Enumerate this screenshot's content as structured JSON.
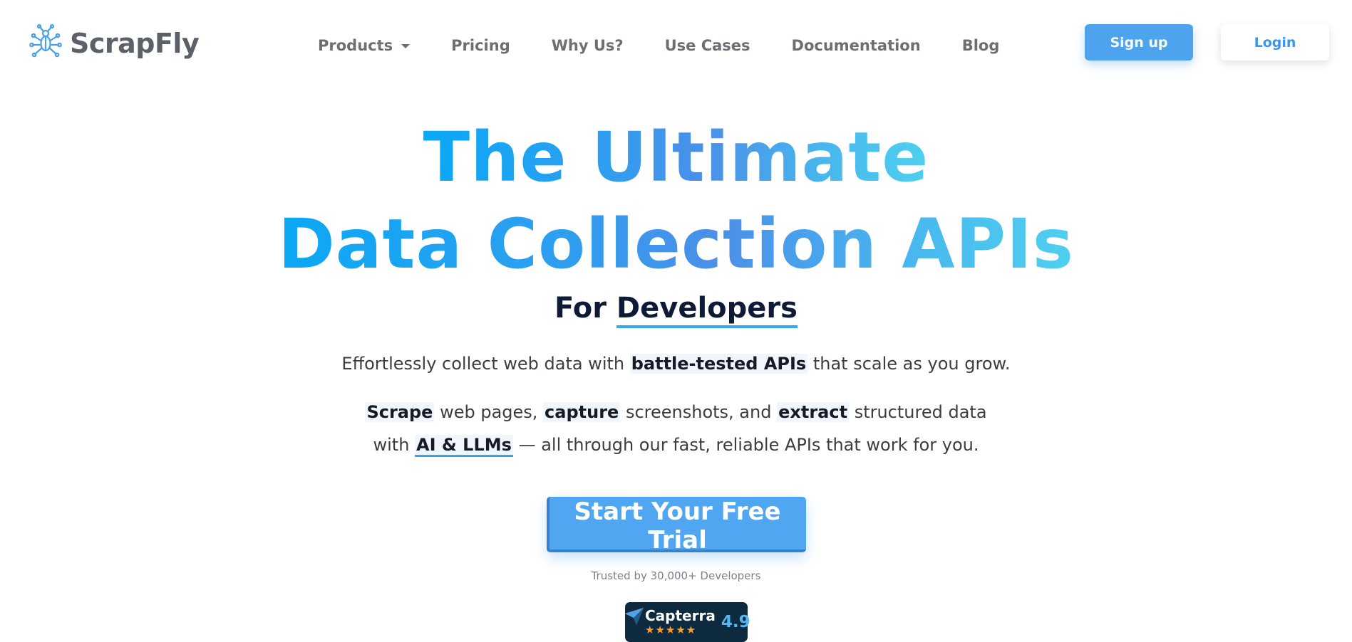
{
  "header": {
    "logo_text": "ScrapFly",
    "nav": [
      {
        "label": "Products",
        "has_dropdown": true
      },
      {
        "label": "Pricing"
      },
      {
        "label": "Why Us?"
      },
      {
        "label": "Use Cases"
      },
      {
        "label": "Documentation"
      },
      {
        "label": "Blog"
      }
    ],
    "signup_label": "Sign up",
    "login_label": "Login"
  },
  "hero": {
    "headline_line1": "The Ultimate",
    "headline_line2": "Data Collection APIs",
    "subhead_prefix": "For",
    "subhead_highlight": "Developers",
    "p1": {
      "before": "Effortlessly collect web data with ",
      "bold": "battle-tested APIs",
      "after": " that scale as you grow."
    },
    "p2": {
      "scrape": "Scrape",
      "t1": " web pages, ",
      "capture": "capture",
      "t2": " screenshots, and ",
      "extract": "extract",
      "t3": " structured data",
      "t4": "with ",
      "ai": "AI & LLMs",
      "t5": " — all through our fast, reliable APIs that work for you."
    },
    "cta_label": "Start Your Free Trial",
    "trusted_text": "Trusted by 30,000+ Developers"
  },
  "capterra": {
    "name": "Capterra",
    "stars": "★★★★★",
    "score": "4.9"
  },
  "colors": {
    "primary": "#4da3ee",
    "heading_dark": "#0e1a36",
    "nav_text": "#6b6e75",
    "capterra_bg": "#0d2a3f",
    "star": "#ff9d28"
  }
}
